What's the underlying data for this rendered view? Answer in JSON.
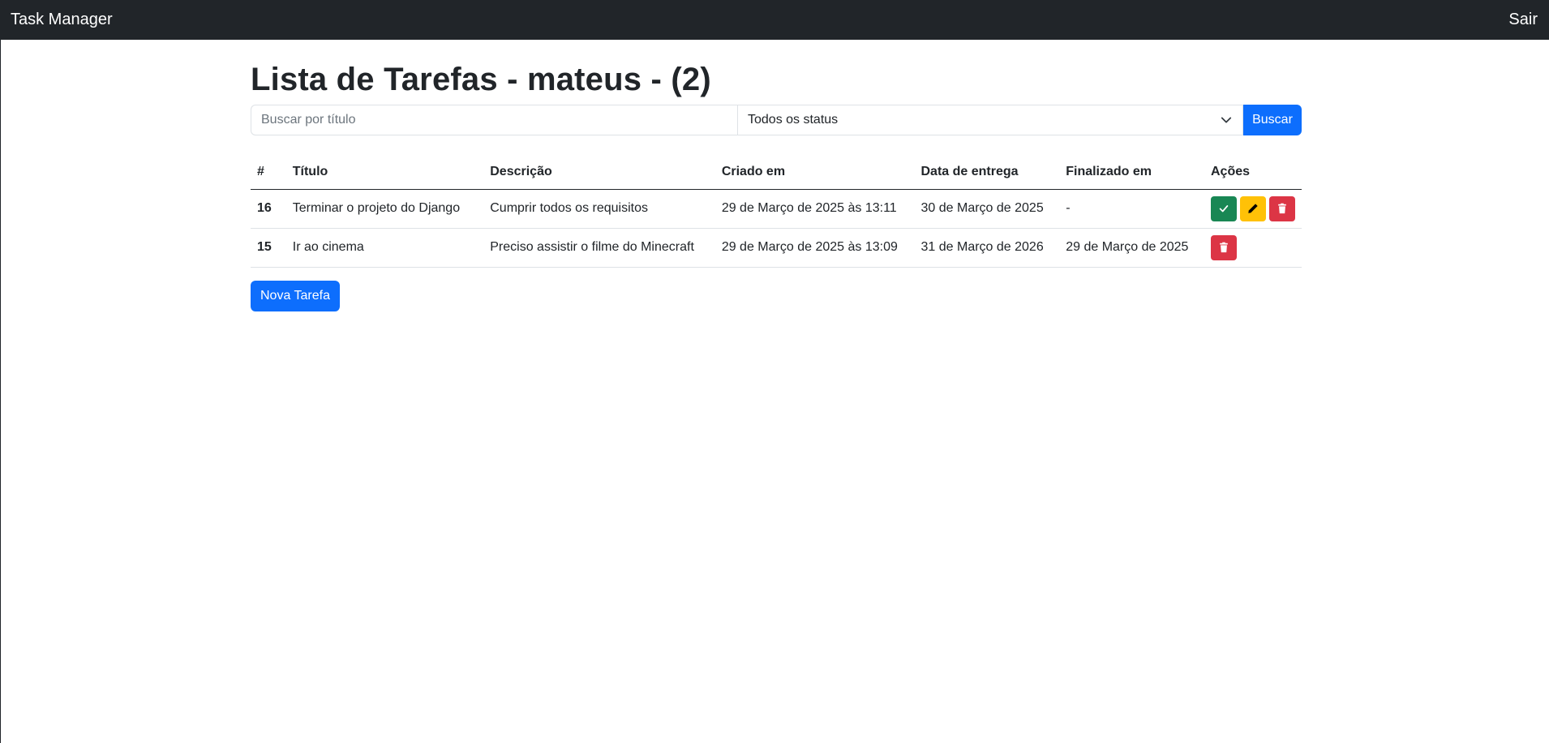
{
  "navbar": {
    "brand": "Task Manager",
    "logout_label": "Sair"
  },
  "page": {
    "title": "Lista de Tarefas - mateus - (2)"
  },
  "filters": {
    "search_placeholder": "Buscar por título",
    "search_value": "",
    "status_selected": "Todos os status",
    "search_button": "Buscar"
  },
  "table": {
    "headers": [
      "#",
      "Título",
      "Descrição",
      "Criado em",
      "Data de entrega",
      "Finalizado em",
      "Ações"
    ],
    "rows": [
      {
        "id": "16",
        "title": "Terminar o projeto do Django",
        "description": "Cumprir todos os requisitos",
        "created": "29 de Março de 2025 às 13:11",
        "due": "30 de Março de 2025",
        "finished": "-",
        "actions": [
          "check-icon",
          "pencil-icon",
          "trash-icon"
        ]
      },
      {
        "id": "15",
        "title": "Ir ao cinema",
        "description": "Preciso assistir o filme do Minecraft",
        "created": "29 de Março de 2025 às 13:09",
        "due": "31 de Março de 2026",
        "finished": "29 de Março de 2025",
        "actions": [
          "trash-icon"
        ]
      }
    ]
  },
  "new_task_button": "Nova Tarefa",
  "colors": {
    "navbar_bg": "#212529",
    "primary": "#0d6efd",
    "success": "#198754",
    "warning": "#ffc107",
    "danger": "#dc3545"
  }
}
